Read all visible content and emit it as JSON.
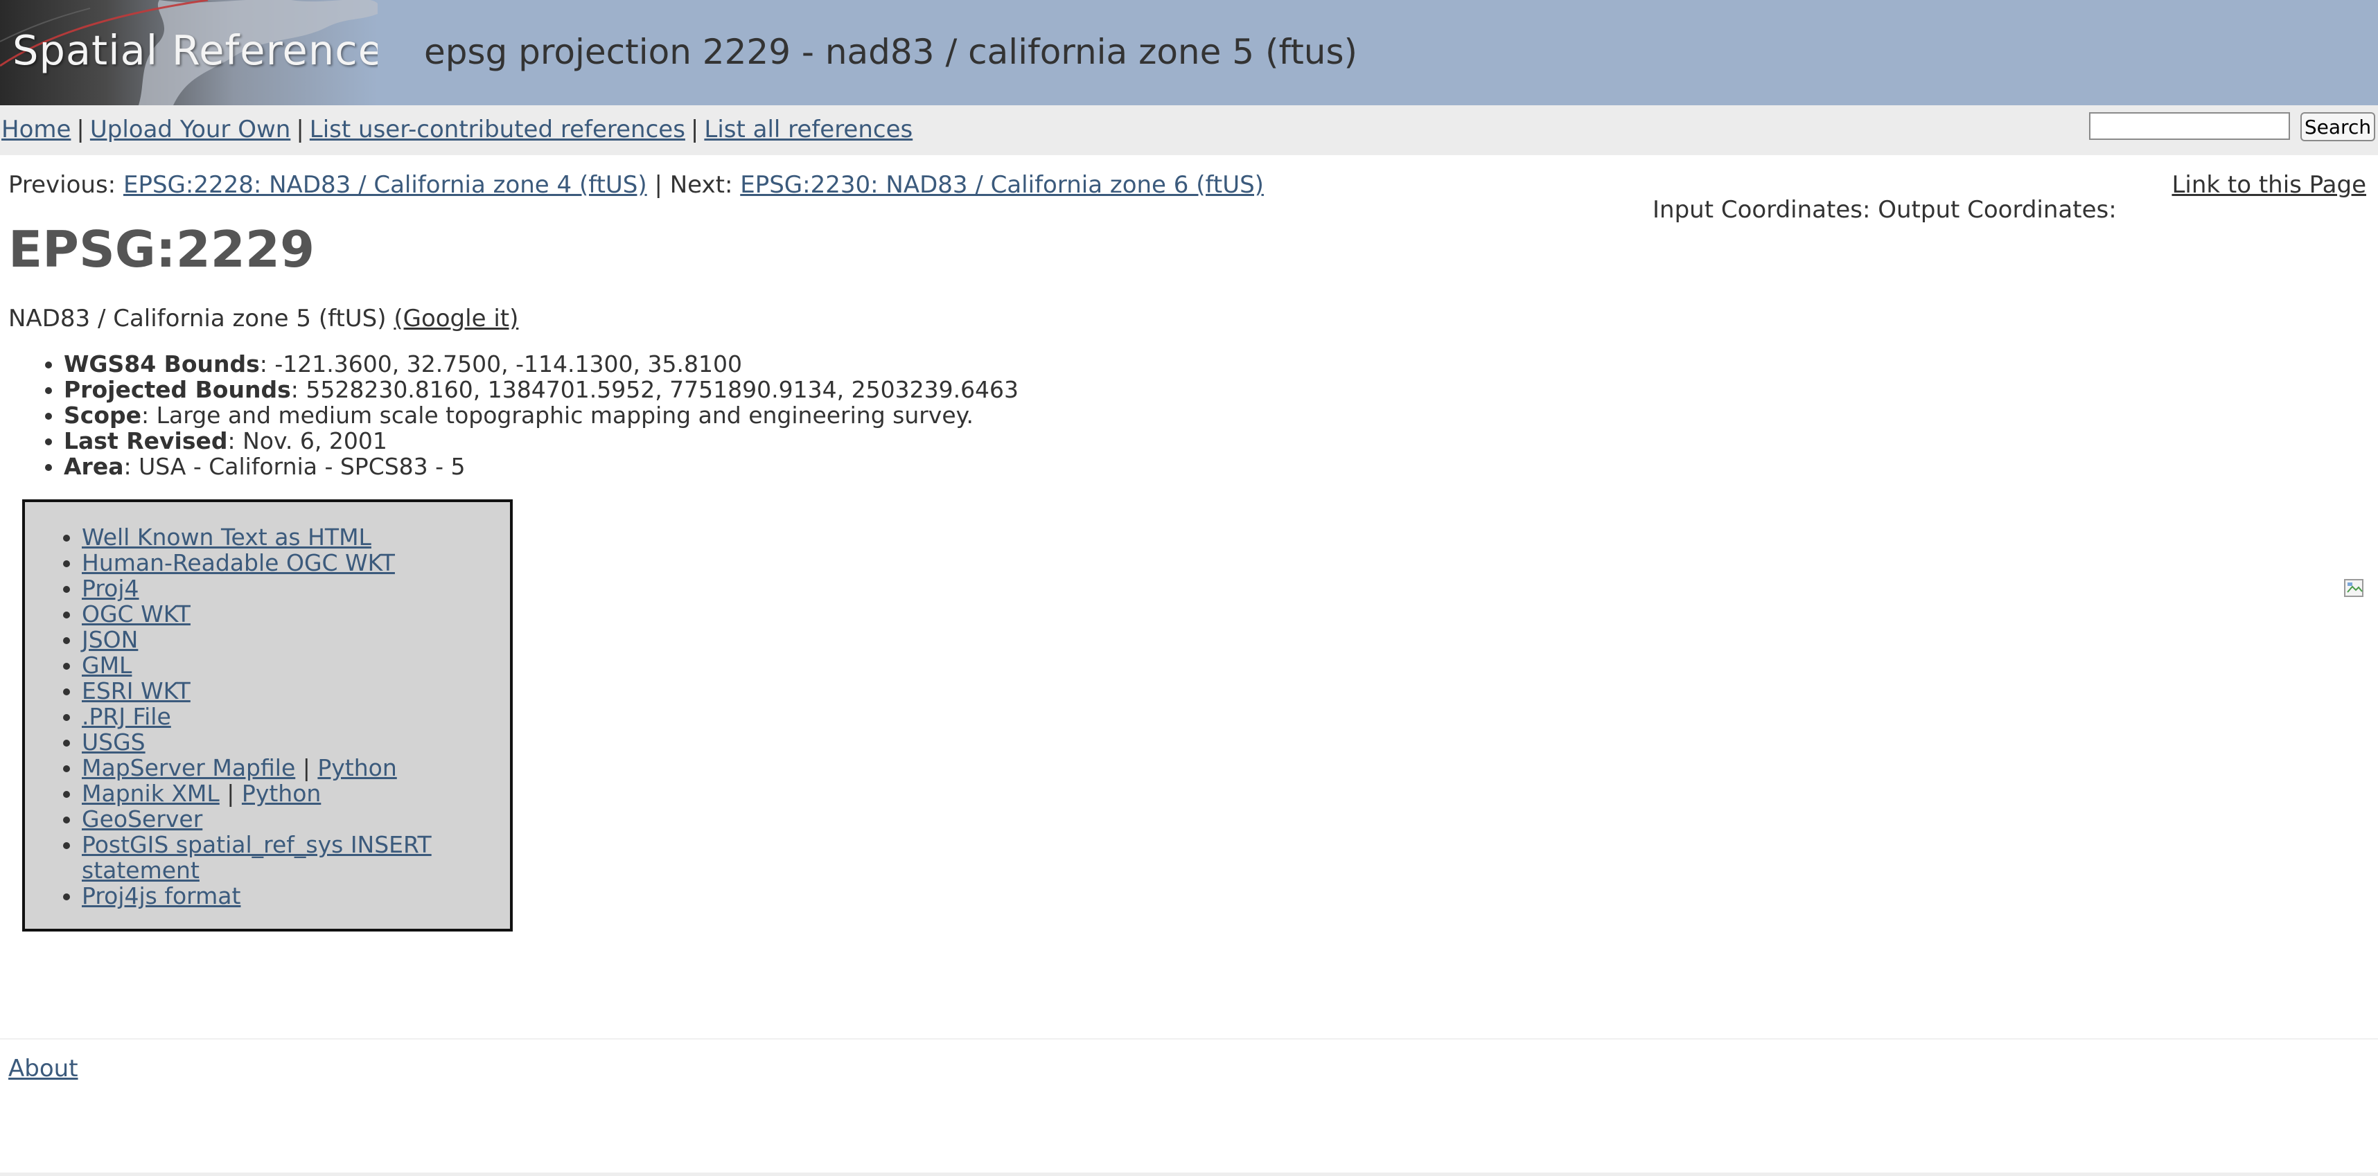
{
  "header": {
    "logo_text": "Spatial Reference",
    "page_heading": "epsg projection 2229 - nad83 / california zone 5 (ftus)",
    "bg_color": "#9eb1cb"
  },
  "nav": {
    "items": [
      {
        "label": "Home"
      },
      {
        "label": "Upload Your Own"
      },
      {
        "label": "List user-contributed references"
      },
      {
        "label": "List all references"
      }
    ],
    "search_placeholder": "",
    "search_button": "Search"
  },
  "prev_next": {
    "prev_label": "Previous:",
    "prev_link": "EPSG:2228: NAD83 / California zone 4 (ftUS)",
    "separator": "|",
    "next_label": "Next:",
    "next_link": "EPSG:2230: NAD83 / California zone 6 (ftUS)"
  },
  "link_to_page": "Link to this Page",
  "coordinates": {
    "input_label": "Input Coordinates:",
    "output_label": "Output Coordinates:"
  },
  "title": "EPSG:2229",
  "subtitle": {
    "name": "NAD83 / California zone 5 (ftUS)",
    "google_link": "(Google it)"
  },
  "properties": [
    {
      "label": "WGS84 Bounds",
      "value": ": -121.3600, 32.7500, -114.1300, 35.8100"
    },
    {
      "label": "Projected Bounds",
      "value": ": 5528230.8160, 1384701.5952, 7751890.9134, 2503239.6463"
    },
    {
      "label": "Scope",
      "value": ": Large and medium scale topographic mapping and engineering survey."
    },
    {
      "label": "Last Revised",
      "value": ": Nov. 6, 2001"
    },
    {
      "label": "Area",
      "value": ": USA - California - SPCS83 - 5"
    }
  ],
  "formats": {
    "wkt_html": "Well Known Text as HTML",
    "human_wkt": "Human-Readable OGC WKT",
    "proj4": "Proj4",
    "ogc_wkt": "OGC WKT",
    "json": "JSON",
    "gml": "GML",
    "esri_wkt": "ESRI WKT",
    "prj_file": ".PRJ File",
    "usgs": "USGS",
    "mapserver": "MapServer Mapfile",
    "mapserver_python": "Python",
    "mapnik": "Mapnik XML",
    "mapnik_python": "Python",
    "geoserver": "GeoServer",
    "postgis": "PostGIS spatial_ref_sys INSERT statement",
    "proj4js": "Proj4js format",
    "pipe": "|"
  },
  "footer": {
    "about": "About"
  }
}
